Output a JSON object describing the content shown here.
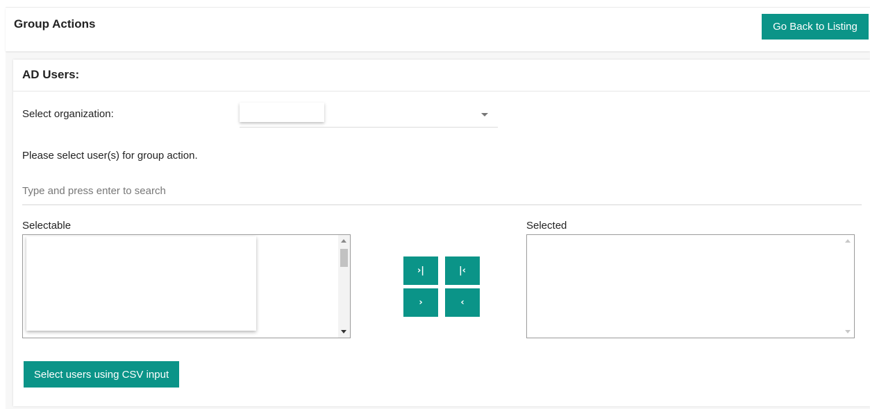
{
  "header": {
    "title": "Group Actions",
    "back_button": "Go Back to Listing"
  },
  "card": {
    "title": "AD Users:",
    "org_label": "Select organization:",
    "org_value": "",
    "instruction": "Please select user(s) for group action.",
    "search_placeholder": "Type and press enter to search",
    "selectable_label": "Selectable",
    "selected_label": "Selected",
    "csv_button": "Select users using CSV input"
  },
  "transfer_buttons": {
    "move_all_right": "›|",
    "move_all_left": "|‹",
    "move_right": "›",
    "move_left": "‹"
  },
  "icons": [
    "dropdown-caret-icon",
    "scroll-up-icon",
    "scroll-down-icon"
  ],
  "colors": {
    "accent": "#0b9488",
    "page_bg": "#f7f7f7"
  }
}
